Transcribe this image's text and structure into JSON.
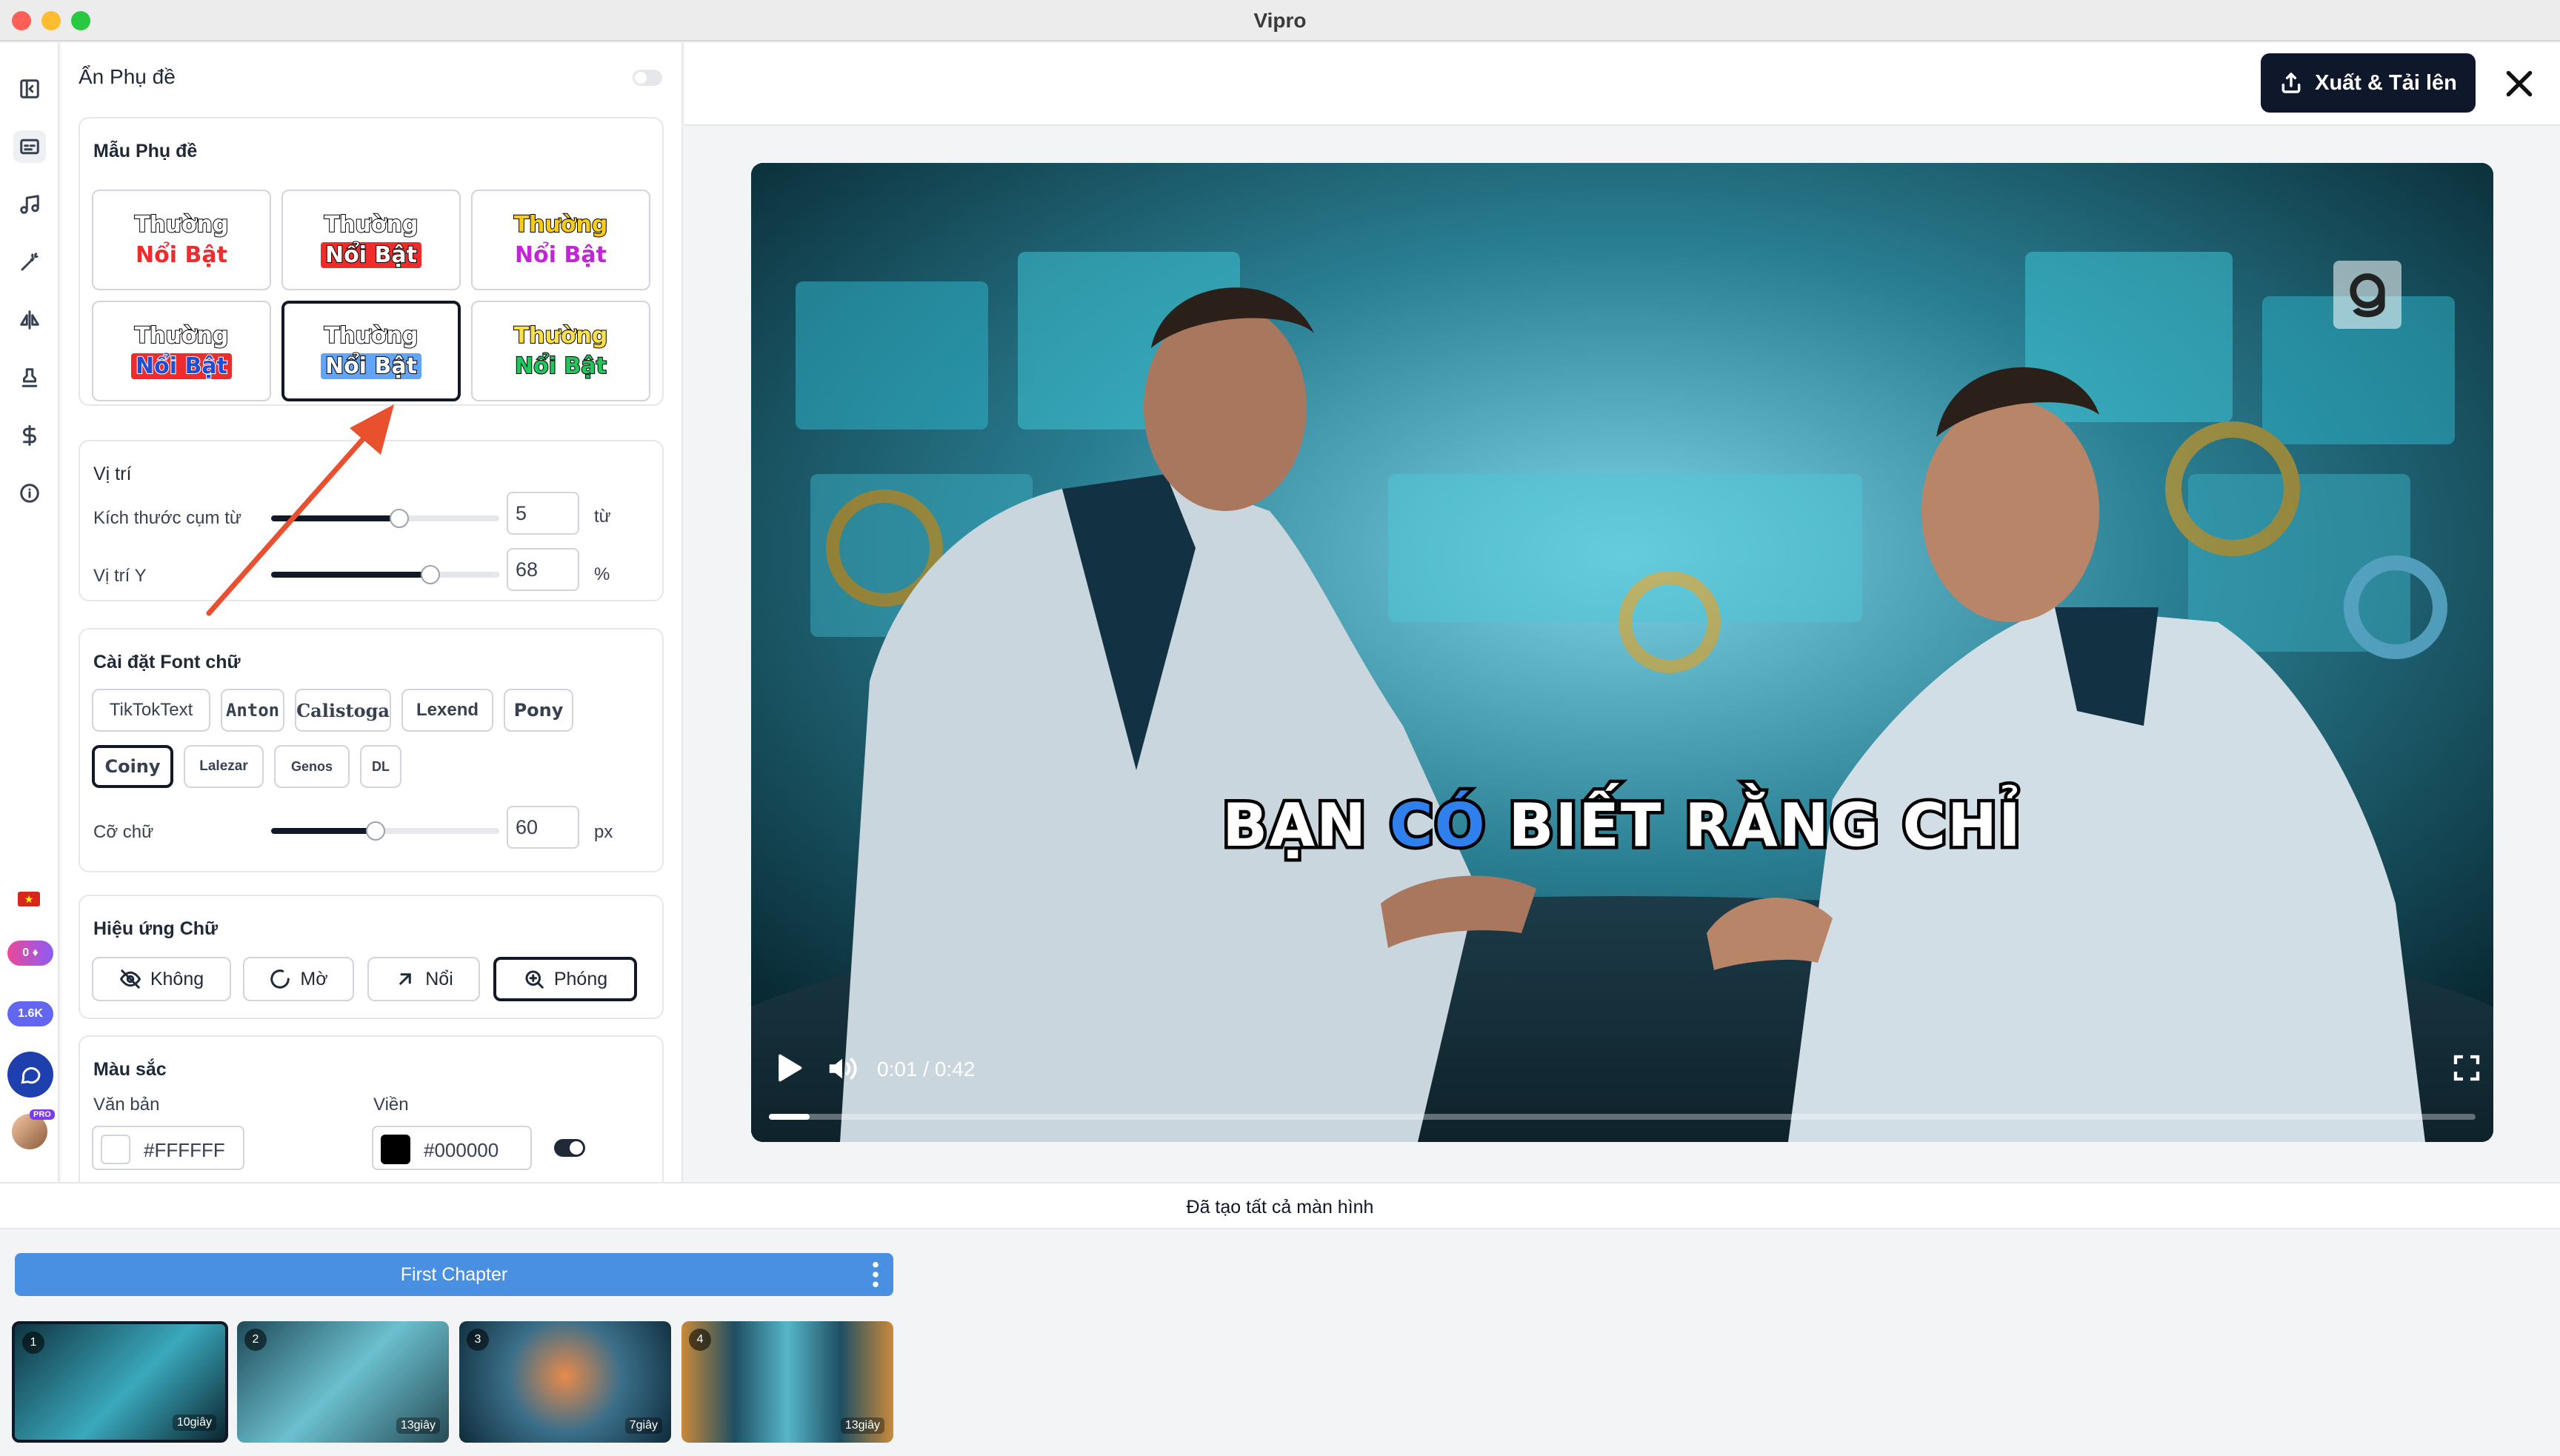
{
  "window": {
    "title": "Vipro"
  },
  "panel": {
    "hide_subtitle_label": "Ẩn Phụ đề",
    "templates": {
      "title": "Mẫu Phụ đề",
      "items": [
        {
          "line1": "Thường",
          "line2": "Nổi Bật"
        },
        {
          "line1": "Thường",
          "line2": "Nổi Bật"
        },
        {
          "line1": "Thường",
          "line2": "Nổi Bật"
        },
        {
          "line1": "Thường",
          "line2": "Nổi Bật"
        },
        {
          "line1": "Thường",
          "line2": "Nổi Bật"
        },
        {
          "line1": "Thường",
          "line2": "Nổi Bật"
        }
      ],
      "selected_index": 4
    },
    "position": {
      "title": "Vị trí",
      "phrase_size_label": "Kích thước cụm từ",
      "phrase_size_value": "5",
      "phrase_size_unit": "từ",
      "phrase_size_fraction": 0.5,
      "y_label": "Vị trí Y",
      "y_value": "68",
      "y_unit": "%",
      "y_fraction": 0.68
    },
    "font": {
      "title": "Cài đặt Font chữ",
      "fonts": [
        "TikTokText",
        "Anton",
        "Calistoga",
        "Lexend",
        "Pony",
        "Coiny",
        "Lalezar",
        "Genos",
        "DL"
      ],
      "selected": "Coiny",
      "size_label": "Cỡ chữ",
      "size_value": "60",
      "size_unit": "px",
      "size_fraction": 0.45
    },
    "effects": {
      "title": "Hiệu ứng Chữ",
      "items": [
        {
          "label": "Không",
          "icon": "eye-off-icon"
        },
        {
          "label": "Mờ",
          "icon": "loader-icon"
        },
        {
          "label": "Nổi",
          "icon": "arrow-up-right-icon"
        },
        {
          "label": "Phóng",
          "icon": "zoom-in-icon"
        }
      ],
      "selected": "Phóng"
    },
    "colors": {
      "title": "Màu sắc",
      "text_label": "Văn bản",
      "text_value": "#FFFFFF",
      "outline_label": "Viền",
      "outline_value": "#000000"
    }
  },
  "sidebar_badges": {
    "gems": "0",
    "credits": "1.6K",
    "pro": "PRO"
  },
  "toolbar": {
    "export_label": "Xuất & Tải lên"
  },
  "video": {
    "subtitle_words": [
      "BẠN",
      "CÓ",
      "BIẾT",
      "RẰNG",
      "CHỈ"
    ],
    "highlight_index": 1,
    "time": "0:01 / 0:42",
    "progress": 0.024
  },
  "status": {
    "message": "Đã tạo tất cả màn hình"
  },
  "timeline": {
    "chapter": "First Chapter",
    "scenes": [
      {
        "num": "1",
        "duration": "10giây"
      },
      {
        "num": "2",
        "duration": "13giây"
      },
      {
        "num": "3",
        "duration": "7giây"
      },
      {
        "num": "4",
        "duration": "13giây"
      }
    ]
  },
  "colors": {
    "accent": "#0f172a",
    "chapter": "#4a90e2",
    "highlight": "#2f80ed",
    "annotation_arrow": "#e8502e"
  }
}
